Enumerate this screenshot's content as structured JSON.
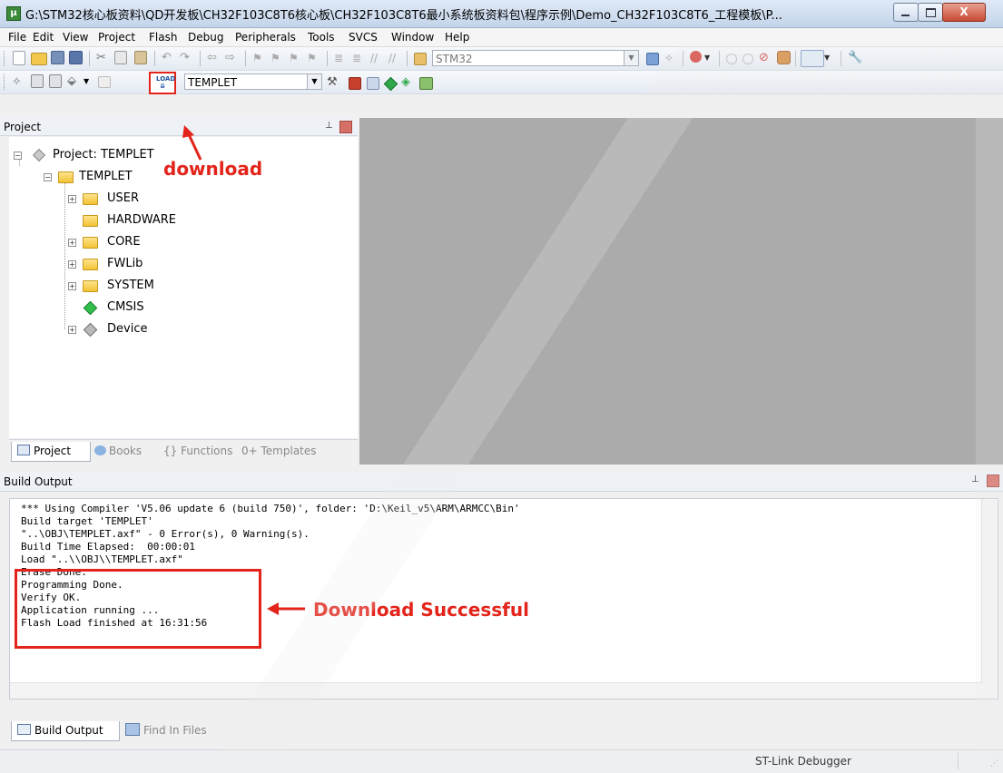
{
  "window": {
    "title": "G:\\STM32核心板资料\\QD开发板\\CH32F103C8T6核心板\\CH32F103C8T6最小系统板资料包\\程序示例\\Demo_CH32F103C8T6_工程模板\\P...",
    "close_glyph": "X"
  },
  "menu": [
    "File",
    "Edit",
    "View",
    "Project",
    "Flash",
    "Debug",
    "Peripherals",
    "Tools",
    "SVCS",
    "Window",
    "Help"
  ],
  "toolbar": {
    "device_combo": "STM32",
    "target_combo": "TEMPLET",
    "load_icon_text": "LOAD"
  },
  "project_panel": {
    "title": "Project",
    "tree": [
      {
        "label": "Project: TEMPLET",
        "icon": "project-icon"
      },
      {
        "label": "TEMPLET",
        "icon": "target-folder-icon"
      },
      {
        "label": "USER",
        "icon": "folder-icon"
      },
      {
        "label": "HARDWARE",
        "icon": "folder-icon"
      },
      {
        "label": "CORE",
        "icon": "folder-icon"
      },
      {
        "label": "FWLib",
        "icon": "folder-icon"
      },
      {
        "label": "SYSTEM",
        "icon": "folder-icon"
      },
      {
        "label": "CMSIS",
        "icon": "green-diamond-icon"
      },
      {
        "label": "Device",
        "icon": "gray-diamond-icon"
      }
    ],
    "tabs": [
      "Project",
      "Books",
      "{} Functions",
      "0+ Templates"
    ]
  },
  "build_output": {
    "title": "Build Output",
    "lines": [
      "*** Using Compiler 'V5.06 update 6 (build 750)', folder: 'D:\\Keil_v5\\ARM\\ARMCC\\Bin'",
      "Build target 'TEMPLET'",
      "\"..\\OBJ\\TEMPLET.axf\" - 0 Error(s), 0 Warning(s).",
      "Build Time Elapsed:  00:00:01",
      "Load \"..\\\\OBJ\\\\TEMPLET.axf\"",
      "Erase Done.",
      "Programming Done.",
      "Verify OK.",
      "Application running ...",
      "Flash Load finished at 16:31:56"
    ],
    "tabs": [
      "Build Output",
      "Find In Files"
    ]
  },
  "status": {
    "debugger": "ST-Link Debugger"
  },
  "annotations": {
    "download": "download",
    "download_successful": "Download Successful",
    "color": "#e3241b"
  }
}
